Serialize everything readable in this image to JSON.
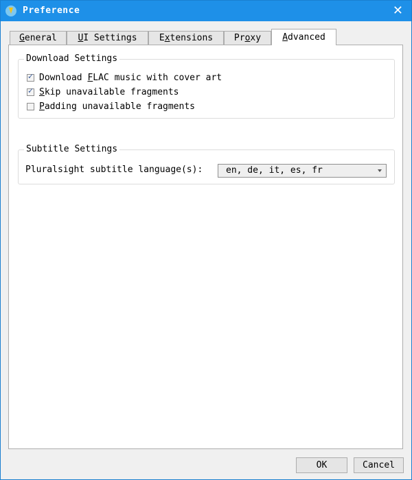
{
  "window": {
    "title": "Preference",
    "close_label": "✕"
  },
  "tabs": [
    {
      "pre": "",
      "mnemonic": "G",
      "post": "eneral"
    },
    {
      "pre": "",
      "mnemonic": "U",
      "post": "I Settings"
    },
    {
      "pre": "E",
      "mnemonic": "x",
      "post": "tensions"
    },
    {
      "pre": "Pr",
      "mnemonic": "o",
      "post": "xy"
    },
    {
      "pre": "",
      "mnemonic": "A",
      "post": "dvanced"
    }
  ],
  "active_tab": "Advanced",
  "download_settings": {
    "title": "Download Settings",
    "options": [
      {
        "pre": "Download ",
        "mnemonic": "F",
        "post": "LAC music with cover art",
        "checked": true
      },
      {
        "pre": "",
        "mnemonic": "S",
        "post": "kip unavailable fragments",
        "checked": true
      },
      {
        "pre": "",
        "mnemonic": "P",
        "post": "adding unavailable fragments",
        "checked": false
      }
    ]
  },
  "subtitle_settings": {
    "title": "Subtitle Settings",
    "label": "Pluralsight subtitle language(s):",
    "selected_value": "en, de, it, es, fr"
  },
  "footer": {
    "ok_label": "OK",
    "cancel_label": "Cancel"
  }
}
